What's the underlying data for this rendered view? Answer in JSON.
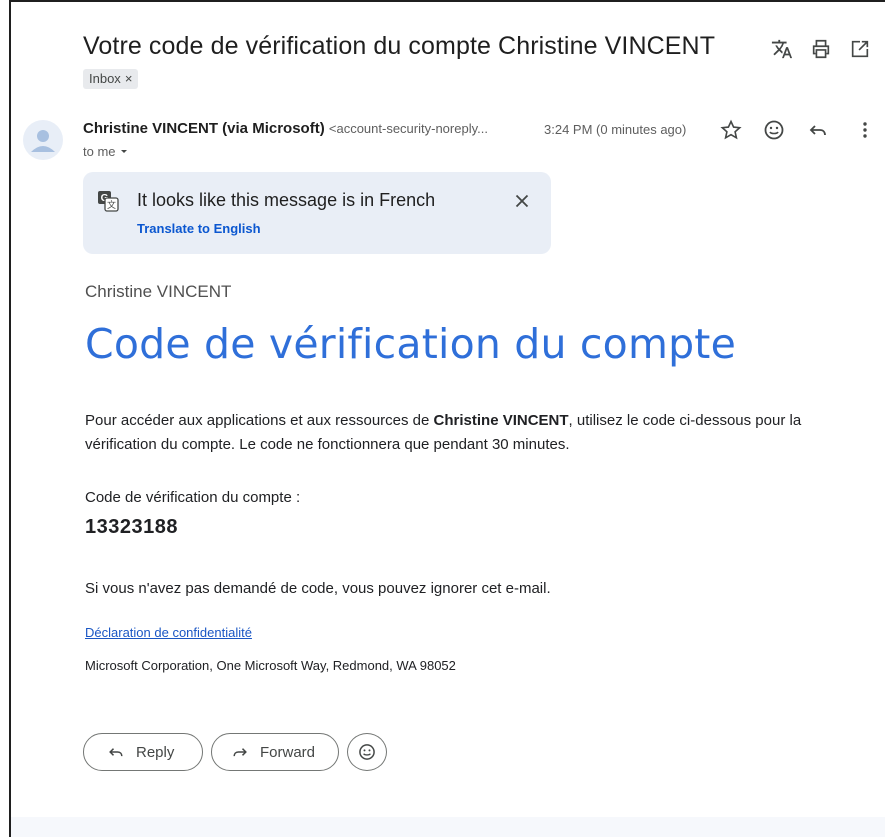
{
  "email": {
    "subject": "Votre code de vérification du compte Christine VINCENT",
    "label_chip": "Inbox",
    "label_chip_close": "×",
    "sender_name": "Christine VINCENT (via Microsoft)",
    "sender_email": "<account-security-noreply...",
    "recipient": "to me",
    "time": "3:24 PM (0 minutes ago)"
  },
  "translate_banner": {
    "message": "It looks like this message is in French",
    "link": "Translate to English"
  },
  "content": {
    "org_name": "Christine VINCENT",
    "headline": "Code de vérification du compte",
    "para_prefix": "Pour accéder aux applications et aux ressources de ",
    "para_bold": "Christine VINCENT",
    "para_suffix": ", utilisez le code ci-dessous pour la vérification du compte. Le code ne fonctionnera que pendant 30 minutes.",
    "code_label": "Code de vérification du compte :",
    "code": "13323188",
    "ignore_text": "Si vous n'avez pas demandé de code, vous pouvez ignorer cet e-mail.",
    "privacy_link": "Déclaration de confidentialité",
    "address": "Microsoft Corporation, One Microsoft Way, Redmond, WA 98052"
  },
  "actions": {
    "reply_label": "Reply",
    "forward_label": "Forward"
  },
  "icons": {
    "header": [
      "translate-icon",
      "print-icon",
      "open-in-new-icon"
    ],
    "row": [
      "star-icon",
      "emoji-icon",
      "reply-icon",
      "more-vert-icon"
    ]
  },
  "colors": {
    "headline": "#2f6fd9",
    "link": "#0b57d0",
    "banner_bg": "#e9eef6"
  }
}
